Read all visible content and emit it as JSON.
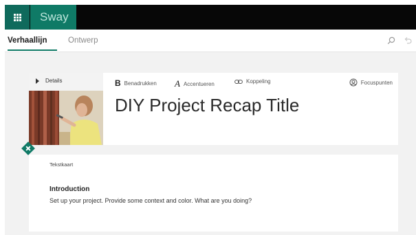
{
  "app": {
    "name": "Sway"
  },
  "tabs": [
    {
      "label": "Verhaallijn",
      "active": true
    },
    {
      "label": "Ontwerp",
      "active": false
    }
  ],
  "toolbar_right": {
    "search_icon": "search-icon",
    "undo_icon": "undo-icon"
  },
  "title_card": {
    "details_label": "Details",
    "format_buttons": {
      "bold_glyph": "B",
      "bold_label": "Benadrukken",
      "accent_glyph": "A",
      "accent_label": "Accentueren",
      "link_label": "Koppeling",
      "focus_label": "Focuspunten"
    },
    "title": "DIY Project Recap Title"
  },
  "text_card": {
    "kind_label": "Tekstkaart",
    "heading": "Introduction",
    "body": "Set up your project. Provide some context and color.  What are you doing?"
  },
  "colors": {
    "accent": "#0f7a66",
    "topbar": "#070707",
    "canvas": "#f2f2f2"
  }
}
